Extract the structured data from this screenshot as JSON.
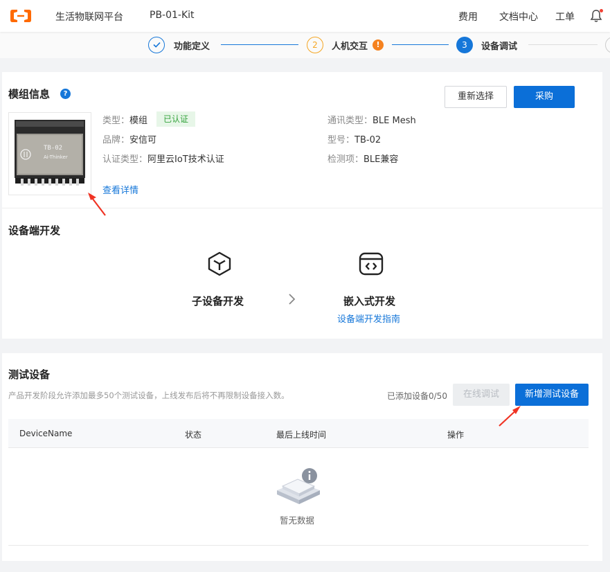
{
  "header": {
    "brand": "生活物联网平台",
    "product": "PB-01-Kit",
    "nav": [
      "费用",
      "文档中心",
      "工单"
    ],
    "icons": [
      "aliyun-logo-icon",
      "bell-icon"
    ]
  },
  "steps": [
    {
      "index": "1",
      "label": "功能定义",
      "state": "done"
    },
    {
      "index": "2",
      "label": "人机交互",
      "state": "warning",
      "badge": "!"
    },
    {
      "index": "3",
      "label": "设备调试",
      "state": "current"
    }
  ],
  "module": {
    "title": "模组信息",
    "help": "?",
    "reselect_label": "重新选择",
    "purchase_label": "采购",
    "image_text": "TB-02",
    "image_brand": "Ai-Thinker",
    "type_key": "类型：",
    "type_value": "模组",
    "cert_tag": "已认证",
    "brand_key": "品牌：",
    "brand_value": "安信可",
    "cert_type_key": "认证类型：",
    "cert_type_value": "阿里云IoT技术认证",
    "comm_key": "通讯类型：",
    "comm_value": "BLE Mesh",
    "model_key": "型号：",
    "model_value": "TB-02",
    "check_key": "检测项：",
    "check_value": "BLE兼容",
    "detail_link": "查看详情"
  },
  "device_dev": {
    "title": "设备端开发",
    "sub_label": "子设备开发",
    "embedded_label": "嵌入式开发",
    "guide_link": "设备端开发指南"
  },
  "test": {
    "title": "测试设备",
    "hint": "产品开发阶段允许添加最多50个测试设备，上线发布后将不再限制设备接入数。",
    "count": "已添加设备0/50",
    "online_debug_label": "在线调试",
    "add_label": "新增测试设备",
    "columns": [
      "DeviceName",
      "状态",
      "最后上线时间",
      "操作"
    ],
    "empty_text": "暂无数据"
  },
  "colors": {
    "primary": "#0b6fd8",
    "step_blue": "#1677d9",
    "warning": "#f5a623",
    "accent_orange": "#ff6a00",
    "success_bg": "#e7f6e8",
    "success_text": "#35a33d",
    "annotation_red": "#f03323"
  }
}
